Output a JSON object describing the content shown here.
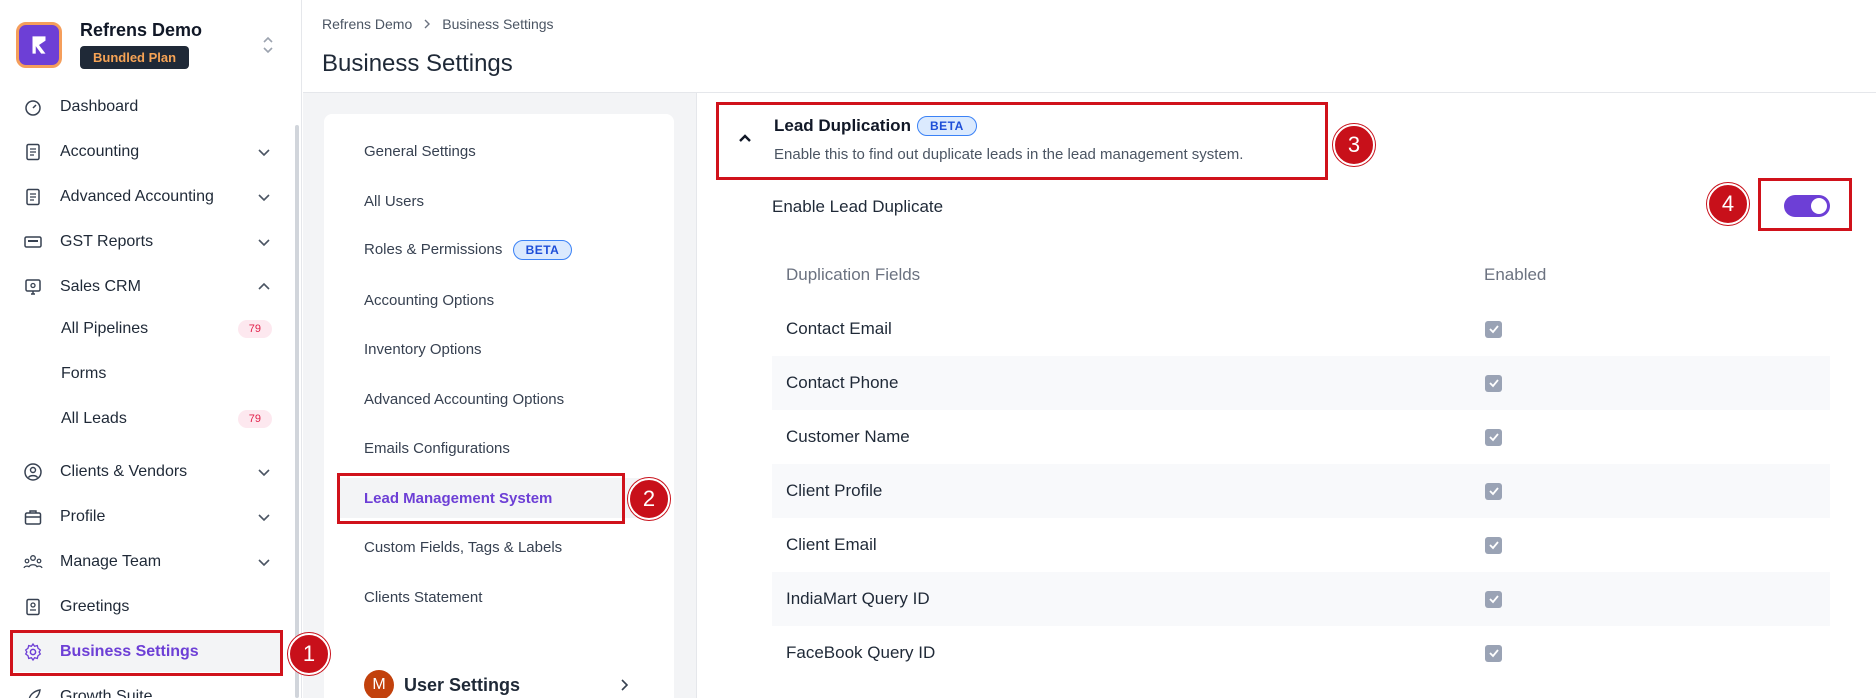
{
  "sidebar": {
    "org_name": "Refrens Demo",
    "org_plan": "Bundled Plan",
    "items": [
      {
        "label": "Dashboard",
        "icon": "dashboard-icon"
      },
      {
        "label": "Accounting",
        "icon": "document-icon"
      },
      {
        "label": "Advanced Accounting",
        "icon": "document-icon"
      },
      {
        "label": "GST Reports",
        "icon": "gst-icon"
      },
      {
        "label": "Sales CRM",
        "icon": "crm-icon"
      },
      {
        "label": "All Pipelines",
        "badge": "79"
      },
      {
        "label": "Forms"
      },
      {
        "label": "All Leads",
        "badge": "79"
      },
      {
        "label": "Clients & Vendors",
        "icon": "user-circle-icon"
      },
      {
        "label": "Profile",
        "icon": "briefcase-icon"
      },
      {
        "label": "Manage Team",
        "icon": "team-icon"
      },
      {
        "label": "Greetings",
        "icon": "greeting-card-icon"
      },
      {
        "label": "Business Settings",
        "icon": "gear-icon"
      },
      {
        "label": "Growth Suite",
        "icon": "rocket-icon"
      }
    ]
  },
  "header": {
    "breadcrumb": [
      "Refrens Demo",
      "Business Settings"
    ],
    "title": "Business Settings"
  },
  "settings_menu": {
    "items": [
      {
        "label": "General Settings"
      },
      {
        "label": "All Users"
      },
      {
        "label": "Roles & Permissions",
        "badge": "BETA"
      },
      {
        "label": "Accounting Options"
      },
      {
        "label": "Inventory Options"
      },
      {
        "label": "Advanced Accounting Options"
      },
      {
        "label": "Emails Configurations"
      },
      {
        "label": "Lead Management System"
      },
      {
        "label": "Custom Fields, Tags & Labels"
      },
      {
        "label": "Clients Statement"
      }
    ],
    "user_settings_label": "User Settings",
    "user_avatar_initial": "M"
  },
  "lead_duplication": {
    "title": "Lead Duplication",
    "badge": "BETA",
    "description": "Enable this to find out duplicate leads in the lead management system.",
    "enable_label": "Enable Lead Duplicate",
    "enabled": true,
    "table": {
      "headers": [
        "Duplication Fields",
        "Enabled"
      ],
      "rows": [
        {
          "field": "Contact Email",
          "enabled": true
        },
        {
          "field": "Contact Phone",
          "enabled": true
        },
        {
          "field": "Customer Name",
          "enabled": true
        },
        {
          "field": "Client Profile",
          "enabled": true
        },
        {
          "field": "Client Email",
          "enabled": true
        },
        {
          "field": "IndiaMart Query ID",
          "enabled": true
        },
        {
          "field": "FaceBook Query ID",
          "enabled": true
        }
      ]
    }
  },
  "annotations": [
    "1",
    "2",
    "3",
    "4"
  ],
  "colors": {
    "accent": "#6d3fd6",
    "highlight": "#d0121b",
    "plan_badge_text": "#f6a355"
  }
}
